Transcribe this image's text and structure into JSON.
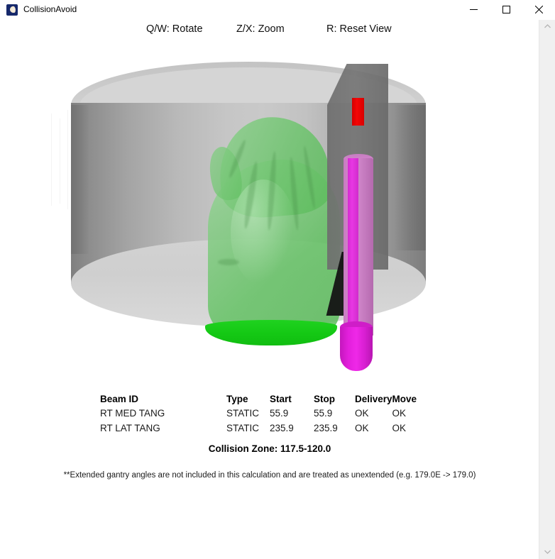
{
  "window": {
    "title": "CollisionAvoid",
    "icon": "app-icon",
    "minimize_label": "Minimize",
    "maximize_label": "Maximize",
    "close_label": "Close"
  },
  "hints": {
    "rotate": "Q/W: Rotate",
    "zoom": "Z/X: Zoom",
    "reset": "R: Reset View"
  },
  "viewport": {
    "name": "3d-collision-view",
    "objects": {
      "bore_cylinder": "gantry-bore-cylinder",
      "patient": "patient-torso-mesh",
      "collimator_slab": "collimator-head-slab",
      "beam": "treatment-beam-cylinder",
      "beam_tip": "beam-collision-tip"
    },
    "colors": {
      "bore": "#c9c9c9",
      "patient": "#57b957",
      "patient_solid": "#14c814",
      "slab": "#6e6e6e",
      "beam": "#e838e3",
      "beam_tip": "#f40606"
    }
  },
  "table": {
    "columns": [
      "Beam ID",
      "Type",
      "Start",
      "Stop",
      "Delivery",
      "Move"
    ],
    "rows": [
      {
        "beam_id": "RT MED TANG",
        "type": "STATIC",
        "start": "55.9",
        "stop": "55.9",
        "delivery": "OK",
        "move": "OK"
      },
      {
        "beam_id": "RT LAT TANG",
        "type": "STATIC",
        "start": "235.9",
        "stop": "235.9",
        "delivery": "OK",
        "move": "OK"
      }
    ]
  },
  "collision_zone": "Collision Zone: 117.5-120.0",
  "footnote": "**Extended gantry angles are not included in this calculation and are treated as unextended (e.g. 179.0E -> 179.0)",
  "scrollbar": {
    "up_arrow": "scroll-up-arrow",
    "down_arrow": "scroll-down-arrow"
  }
}
